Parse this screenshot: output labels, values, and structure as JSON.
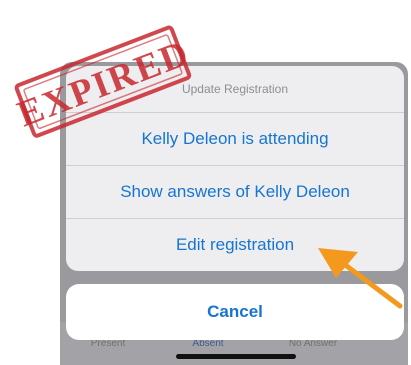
{
  "sheet": {
    "title": "Update Registration",
    "actions": [
      "Kelly Deleon is attending",
      "Show answers of Kelly Deleon",
      "Edit registration"
    ],
    "cancel": "Cancel"
  },
  "tabs": {
    "present": "Present",
    "absent": "Absent",
    "no_answer": "No Answer"
  },
  "stamp": {
    "text": "EXPIRED",
    "color": "#c8282e"
  },
  "annotation": {
    "arrow_color": "#f39a1e",
    "icon": "arrow-icon"
  },
  "colors": {
    "action_blue": "#1675d1",
    "dim_background": "#9a9a9e"
  }
}
